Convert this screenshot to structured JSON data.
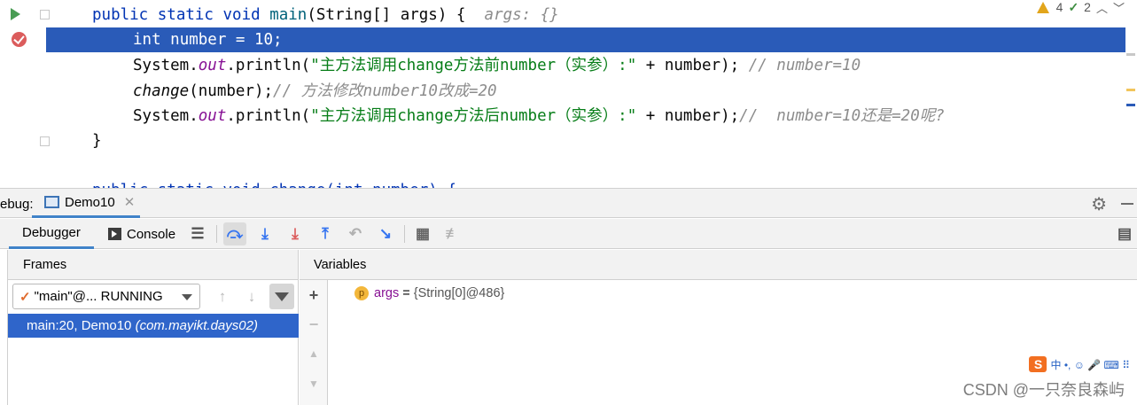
{
  "editor": {
    "lines": [
      {
        "parts": [
          {
            "t": "public static void ",
            "c": "kw"
          },
          {
            "t": "main",
            "c": "fn"
          },
          {
            "t": "(String[] args) {  ",
            "c": ""
          },
          {
            "t": "args: {}",
            "c": "hint"
          }
        ]
      },
      {
        "parts": [
          {
            "t": "int ",
            "c": "kw"
          },
          {
            "t": "number = 10;",
            "c": ""
          }
        ]
      },
      {
        "parts": [
          {
            "t": "System.",
            "c": ""
          },
          {
            "t": "out",
            "c": "fld"
          },
          {
            "t": ".println(",
            "c": ""
          },
          {
            "t": "\"主方法调用change方法前number（实参）:\"",
            "c": "str"
          },
          {
            "t": " + number); ",
            "c": ""
          },
          {
            "t": "// number=10",
            "c": "cmt"
          }
        ]
      },
      {
        "parts": [
          {
            "t": "change",
            "c": "it"
          },
          {
            "t": "(number);",
            "c": ""
          },
          {
            "t": "// 方法修改number10改成=20",
            "c": "cmt"
          }
        ]
      },
      {
        "parts": [
          {
            "t": "System.",
            "c": ""
          },
          {
            "t": "out",
            "c": "fld"
          },
          {
            "t": ".println(",
            "c": ""
          },
          {
            "t": "\"主方法调用change方法后number（实参）:\"",
            "c": "str"
          },
          {
            "t": " + number);",
            "c": ""
          },
          {
            "t": "//  number=10还是=20呢?",
            "c": "cmt"
          }
        ]
      },
      {
        "parts": [
          {
            "t": "}",
            "c": ""
          }
        ]
      },
      {
        "parts": [
          {
            "t": "",
            "c": ""
          }
        ]
      },
      {
        "parts": [
          {
            "t": "public static void change(int number) {",
            "c": "kw"
          }
        ]
      }
    ],
    "inspections": {
      "warnings": "4",
      "typos": "2"
    }
  },
  "debug": {
    "title": "ebug:",
    "run_tab": "Demo10",
    "tabs": {
      "debugger": "Debugger",
      "console": "Console"
    },
    "frames_title": "Frames",
    "variables_title": "Variables",
    "thread": "\"main\"@... RUNNING",
    "frame": {
      "location": "main:20, Demo10 ",
      "package": "(com.mayikt.days02)"
    },
    "variable": {
      "badge": "p",
      "name": "args",
      "eq": " = ",
      "value": "{String[0]@486}"
    }
  },
  "overlay": {
    "ime_logo": "S",
    "ime_text": "中 •, ☺ 🎤 ⌨ ⠿",
    "watermark": "CSDN @一只奈良森屿"
  }
}
